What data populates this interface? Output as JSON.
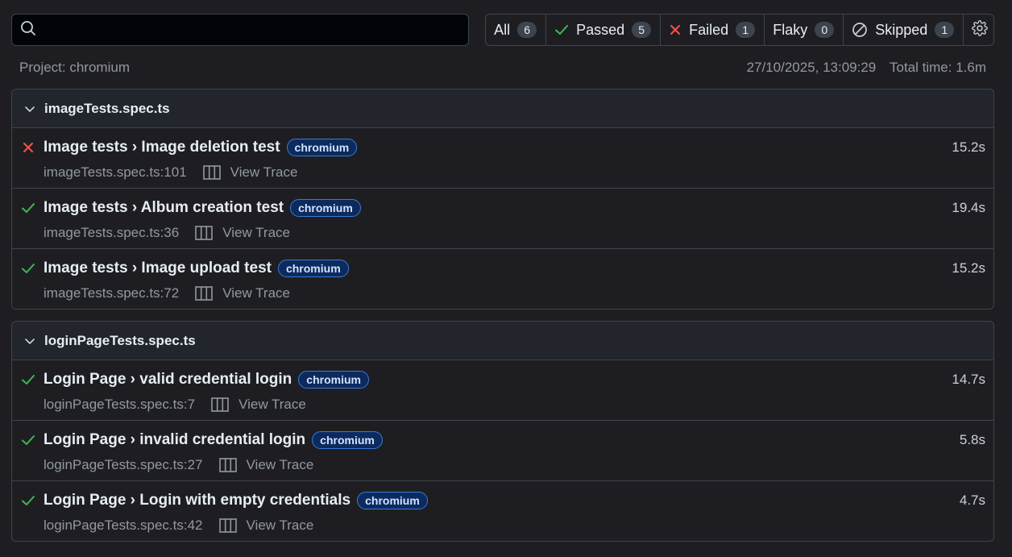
{
  "search": {
    "value": "",
    "placeholder": ""
  },
  "filters": [
    {
      "label": "All",
      "count": "6",
      "icon": ""
    },
    {
      "label": "Passed",
      "count": "5",
      "icon": "check-icon"
    },
    {
      "label": "Failed",
      "count": "1",
      "icon": "cross-icon"
    },
    {
      "label": "Flaky",
      "count": "0",
      "icon": ""
    },
    {
      "label": "Skipped",
      "count": "1",
      "icon": "skip-icon"
    }
  ],
  "meta": {
    "project": "Project: chromium",
    "timestamp": "27/10/2025, 13:09:29",
    "total_time": "Total time: 1.6m"
  },
  "colors": {
    "passed": "#3fb950",
    "failed": "#f85149",
    "tag_bg": "#0d2a5e",
    "tag_border": "#3a7bd5"
  },
  "files": [
    {
      "name": "imageTests.spec.ts",
      "tests": [
        {
          "status": "failed",
          "title": "Image tests › Image deletion test",
          "tag": "chromium",
          "location": "imageTests.spec.ts:101",
          "trace": "View Trace",
          "duration": "15.2s"
        },
        {
          "status": "passed",
          "title": "Image tests › Album creation test",
          "tag": "chromium",
          "location": "imageTests.spec.ts:36",
          "trace": "View Trace",
          "duration": "19.4s"
        },
        {
          "status": "passed",
          "title": "Image tests › Image upload test",
          "tag": "chromium",
          "location": "imageTests.spec.ts:72",
          "trace": "View Trace",
          "duration": "15.2s"
        }
      ]
    },
    {
      "name": "loginPageTests.spec.ts",
      "tests": [
        {
          "status": "passed",
          "title": "Login Page › valid credential login",
          "tag": "chromium",
          "location": "loginPageTests.spec.ts:7",
          "trace": "View Trace",
          "duration": "14.7s"
        },
        {
          "status": "passed",
          "title": "Login Page › invalid credential login",
          "tag": "chromium",
          "location": "loginPageTests.spec.ts:27",
          "trace": "View Trace",
          "duration": "5.8s"
        },
        {
          "status": "passed",
          "title": "Login Page › Login with empty credentials",
          "tag": "chromium",
          "location": "loginPageTests.spec.ts:42",
          "trace": "View Trace",
          "duration": "4.7s"
        }
      ]
    }
  ]
}
